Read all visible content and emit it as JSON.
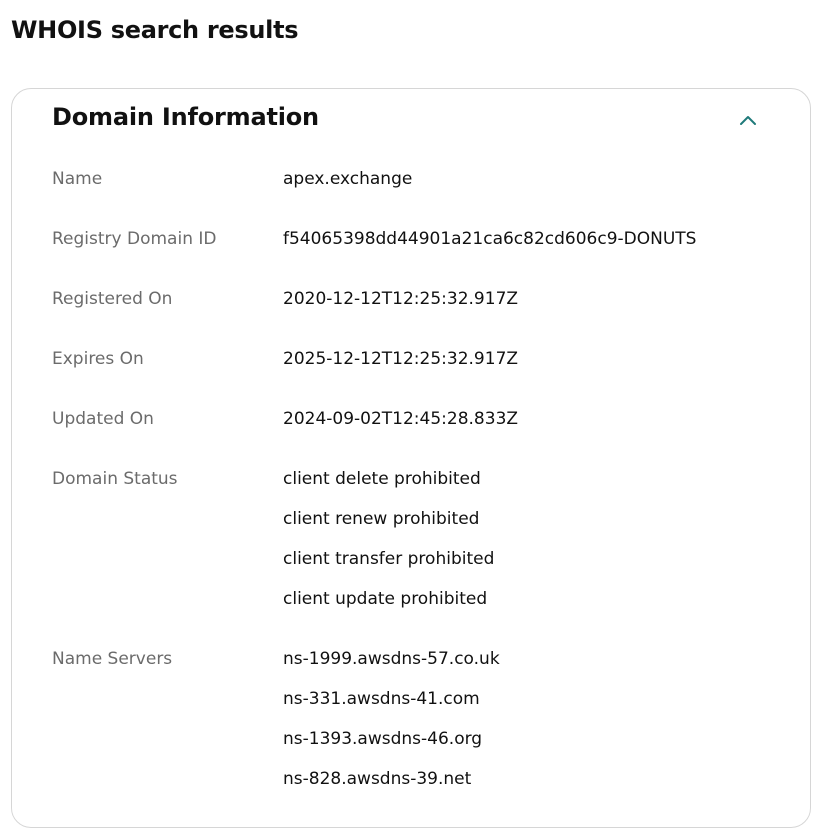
{
  "page": {
    "title": "WHOIS search results"
  },
  "domain_info": {
    "title": "Domain Information",
    "toggle_icon": "chevron-up-icon",
    "accent_color": "#1f7a7a",
    "rows": [
      {
        "label": "Name",
        "values": [
          "apex.exchange"
        ]
      },
      {
        "label": "Registry Domain ID",
        "values": [
          "f54065398dd44901a21ca6c82cd606c9-DONUTS"
        ]
      },
      {
        "label": "Registered On",
        "values": [
          "2020-12-12T12:25:32.917Z"
        ]
      },
      {
        "label": "Expires On",
        "values": [
          "2025-12-12T12:25:32.917Z"
        ]
      },
      {
        "label": "Updated On",
        "values": [
          "2024-09-02T12:45:28.833Z"
        ]
      },
      {
        "label": "Domain Status",
        "values": [
          "client delete prohibited",
          "client renew prohibited",
          "client transfer prohibited",
          "client update prohibited"
        ]
      },
      {
        "label": "Name Servers",
        "values": [
          "ns-1999.awsdns-57.co.uk",
          "ns-331.awsdns-41.com",
          "ns-1393.awsdns-46.org",
          "ns-828.awsdns-39.net"
        ]
      }
    ]
  }
}
